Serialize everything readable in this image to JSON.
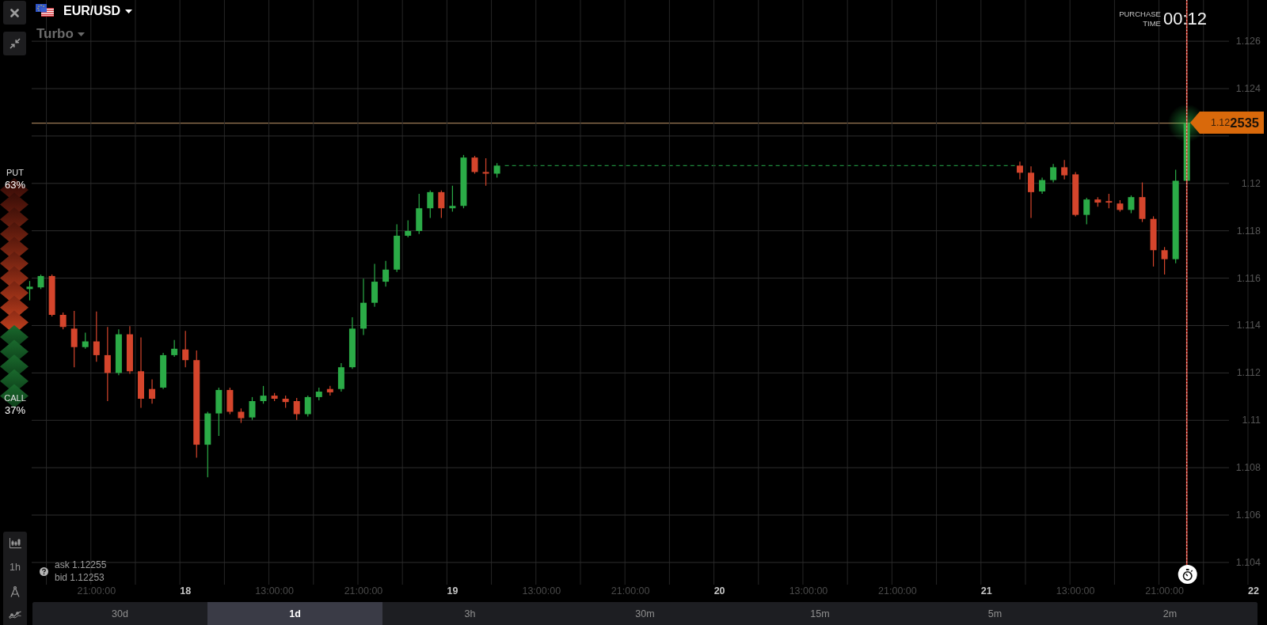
{
  "asset": {
    "name": "EUR/USD"
  },
  "option_type": {
    "label": "Turbo"
  },
  "purchase_time": {
    "label": "PURCHASE TIME",
    "value": "00:12"
  },
  "sentiment": {
    "put_label": "PUT",
    "put_percent": "63%",
    "call_label": "CALL",
    "call_percent": "37%",
    "level": 0.63
  },
  "chart": {
    "current_price": "1.12**2535**",
    "chart_data": {
      "type": "candlestick",
      "categories": [
        null,
        null,
        null,
        null,
        null,
        null,
        "21:00:00",
        null,
        null,
        null,
        null,
        null,
        null,
        null,
        "18",
        null,
        null,
        null,
        null,
        null,
        null,
        null,
        "13:00:00",
        null,
        null,
        null,
        null,
        null,
        null,
        null,
        "21:00:00",
        null,
        null,
        null,
        null,
        null,
        null,
        null,
        "19",
        null,
        null,
        null,
        null,
        null,
        null,
        null,
        "13:00:00",
        null,
        null,
        null,
        null,
        null,
        null,
        null,
        "21:00:00",
        null,
        null,
        null,
        null,
        null,
        null,
        null,
        "20",
        null,
        null,
        null,
        null,
        null,
        null,
        null,
        "13:00:00",
        null,
        null,
        null,
        null,
        null,
        null,
        null,
        "21:00:00",
        null,
        null,
        null,
        null,
        null,
        null,
        null,
        "21",
        null,
        null,
        null,
        null,
        null,
        null,
        null,
        "13:00:00",
        null,
        null,
        null,
        null,
        null,
        null,
        null,
        "21:00:00",
        null,
        null,
        null,
        null,
        null,
        null,
        null,
        "22"
      ],
      "ohlc": [
        [
          1.11554,
          1.11588,
          1.11506,
          1.11564
        ],
        [
          1.11561,
          1.11615,
          1.11554,
          1.11609
        ],
        [
          1.11609,
          1.11615,
          1.11438,
          1.11445
        ],
        [
          1.11445,
          1.11455,
          1.11384,
          1.11394
        ],
        [
          1.11387,
          1.11462,
          1.11224,
          1.11309
        ],
        [
          1.11309,
          1.1137,
          1.11302,
          1.11333
        ],
        [
          1.11333,
          1.11459,
          1.11247,
          1.11275
        ],
        [
          1.11275,
          1.11394,
          1.11081,
          1.112
        ],
        [
          1.112,
          1.11384,
          1.1119,
          1.11363
        ],
        [
          1.11363,
          1.11397,
          1.11196,
          1.11207
        ],
        [
          1.11207,
          1.1135,
          1.11053,
          1.11091
        ],
        [
          1.11132,
          1.11173,
          1.1107,
          1.11091
        ],
        [
          1.11138,
          1.11285,
          1.11132,
          1.11275
        ],
        [
          1.11275,
          1.11339,
          1.11268,
          1.11302
        ],
        [
          1.11299,
          1.11377,
          1.11224,
          1.11254
        ],
        [
          1.11254,
          1.11295,
          1.10842,
          1.10897
        ],
        [
          1.10897,
          1.11036,
          1.1076,
          1.11029
        ],
        [
          1.11029,
          1.11138,
          1.10934,
          1.11128
        ],
        [
          1.11128,
          1.11138,
          1.11026,
          1.11036
        ],
        [
          1.11036,
          1.1105,
          1.10989,
          1.11009
        ],
        [
          1.11012,
          1.11098,
          1.11002,
          1.11081
        ],
        [
          1.11081,
          1.11145,
          1.1107,
          1.11104
        ],
        [
          1.11104,
          1.11115,
          1.11081,
          1.11091
        ],
        [
          1.11091,
          1.11104,
          1.11053,
          1.11077
        ],
        [
          1.11081,
          1.11094,
          1.11002,
          1.11026
        ],
        [
          1.11026,
          1.11104,
          1.11016,
          1.11098
        ],
        [
          1.11098,
          1.11138,
          1.11084,
          1.11121
        ],
        [
          1.11132,
          1.11145,
          1.11104,
          1.11118
        ],
        [
          1.11132,
          1.11241,
          1.11121,
          1.11224
        ],
        [
          1.11224,
          1.11435,
          1.11217,
          1.11387
        ],
        [
          1.11387,
          1.11598,
          1.1136,
          1.11496
        ],
        [
          1.11496,
          1.1166,
          1.11479,
          1.11585
        ],
        [
          1.11585,
          1.11673,
          1.11564,
          1.11636
        ],
        [
          1.11636,
          1.11827,
          1.11626,
          1.11779
        ],
        [
          1.11779,
          1.11844,
          1.11772,
          1.11799
        ],
        [
          1.11799,
          1.11956,
          1.11786,
          1.11895
        ],
        [
          1.11895,
          1.1197,
          1.11854,
          1.11963
        ],
        [
          1.11963,
          1.1197,
          1.11854,
          1.11895
        ],
        [
          1.11895,
          1.1199,
          1.11881,
          1.11905
        ],
        [
          1.11905,
          1.1212,
          1.11895,
          1.12109
        ],
        [
          1.12109,
          1.12116,
          1.12041,
          1.12048
        ],
        [
          1.12048,
          1.12106,
          1.1199,
          1.12041
        ],
        [
          1.12041,
          1.12085,
          1.12024,
          1.12075
        ],
        null,
        null,
        null,
        null,
        null,
        null,
        null,
        null,
        null,
        null,
        null,
        null,
        null,
        null,
        null,
        null,
        null,
        null,
        null,
        null,
        null,
        null,
        null,
        null,
        null,
        null,
        null,
        null,
        null,
        null,
        null,
        null,
        null,
        null,
        null,
        null,
        null,
        null,
        null,
        null,
        null,
        null,
        null,
        null,
        null,
        null,
        [
          1.12075,
          1.12092,
          1.12017,
          1.12045
        ],
        [
          1.12045,
          1.12072,
          1.11854,
          1.11963
        ],
        [
          1.11966,
          1.12024,
          1.11956,
          1.12014
        ],
        [
          1.12014,
          1.12082,
          1.12004,
          1.12068
        ],
        [
          1.12068,
          1.12099,
          1.12017,
          1.12034
        ],
        [
          1.12038,
          1.12048,
          1.11861,
          1.11867
        ],
        [
          1.11867,
          1.11939,
          1.11827,
          1.11932
        ],
        [
          1.11932,
          1.11942,
          1.11902,
          1.11919
        ],
        [
          1.11925,
          1.11956,
          1.11895,
          1.11919
        ],
        [
          1.11915,
          1.11929,
          1.11881,
          1.11888
        ],
        [
          1.11888,
          1.11949,
          1.11874,
          1.11942
        ],
        [
          1.11942,
          1.12004,
          1.11837,
          1.1185
        ],
        [
          1.1185,
          1.11861,
          1.11649,
          1.11718
        ],
        [
          1.11718,
          1.11731,
          1.11615,
          1.1168
        ],
        [
          1.1168,
          1.12058,
          1.11663,
          1.12011
        ],
        [
          1.12011,
          1.12269,
          1.12004,
          1.12254
        ],
        null,
        null,
        null,
        null,
        null,
        null
      ],
      "ylim": [
        1.10146,
        1.12774
      ],
      "yticks": [
        1.126,
        1.124,
        1.12,
        1.118,
        1.116,
        1.114,
        1.112,
        1.11,
        1.108,
        1.106,
        1.104
      ],
      "grid": true
    }
  },
  "quote": {
    "ask": "ask 1.12255",
    "bid": "bid 1.12253"
  },
  "tools": {
    "interval": "1h"
  },
  "timeframes": [
    {
      "label": "30d",
      "selected": false
    },
    {
      "label": "1d",
      "selected": true
    },
    {
      "label": "3h",
      "selected": false
    },
    {
      "label": "30m",
      "selected": false
    },
    {
      "label": "15m",
      "selected": false
    },
    {
      "label": "5m",
      "selected": false
    },
    {
      "label": "2m",
      "selected": false
    }
  ]
}
